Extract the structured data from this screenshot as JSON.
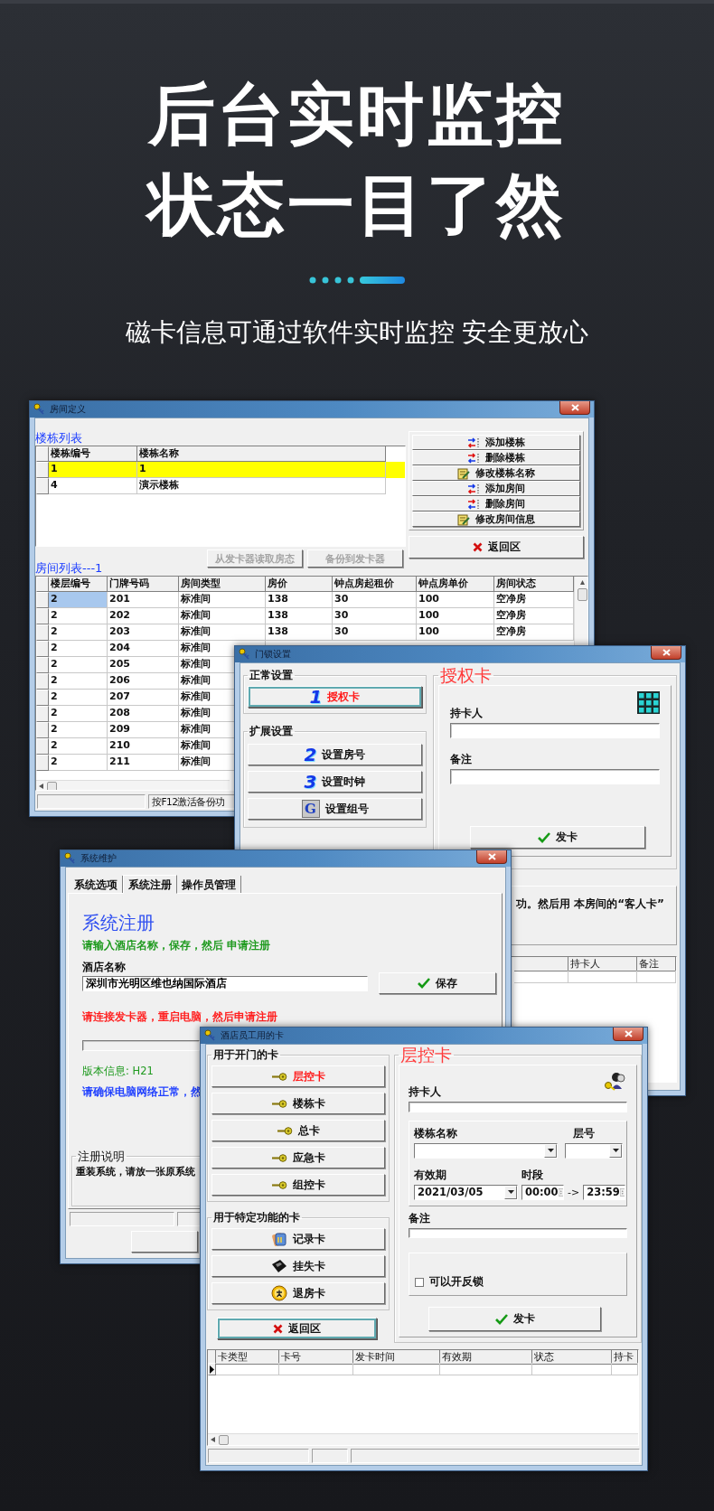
{
  "headline": [
    "后台实时监控",
    "状态一目了然"
  ],
  "subtitle": "磁卡信息可通过软件实时监控 安全更放心",
  "room_window": {
    "title": "房间定义",
    "building_list": {
      "label": "楼栋列表",
      "columns": [
        "楼栋编号",
        "楼栋名称"
      ],
      "rows": [
        {
          "cells": [
            "1",
            "1"
          ],
          "selected": true
        },
        {
          "cells": [
            "4",
            "演示楼栋"
          ],
          "selected": false
        }
      ]
    },
    "actions": [
      {
        "label": "添加楼栋",
        "kind": "add"
      },
      {
        "label": "删除楼栋",
        "kind": "remove"
      },
      {
        "label": "修改楼栋名称",
        "kind": "edit"
      },
      {
        "label": "添加房间",
        "kind": "add"
      },
      {
        "label": "删除房间",
        "kind": "remove"
      },
      {
        "label": "修改房间信息",
        "kind": "edit"
      }
    ],
    "sync_buttons": [
      {
        "label": "从发卡器读取房态",
        "disabled": true
      },
      {
        "label": "备份到发卡器",
        "disabled": true
      }
    ],
    "back_button": "返回区",
    "room_list": {
      "label": "房间列表---1",
      "columns": [
        "楼层编号",
        "门牌号码",
        "房间类型",
        "房价",
        "钟点房起租价",
        "钟点房单价",
        "房间状态"
      ],
      "rows": [
        {
          "cells": [
            "2",
            "201",
            "标准间",
            "138",
            "30",
            "100",
            "空净房"
          ],
          "selected": true
        },
        {
          "cells": [
            "2",
            "202",
            "标准间",
            "138",
            "30",
            "100",
            "空净房"
          ],
          "selected": false
        },
        {
          "cells": [
            "2",
            "203",
            "标准间",
            "138",
            "30",
            "100",
            "空净房"
          ],
          "selected": false
        },
        {
          "cells": [
            "2",
            "204",
            "标准间"
          ],
          "selected": false
        },
        {
          "cells": [
            "2",
            "205",
            "标准间"
          ],
          "selected": false
        },
        {
          "cells": [
            "2",
            "206",
            "标准间"
          ],
          "selected": false
        },
        {
          "cells": [
            "2",
            "207",
            "标准间"
          ],
          "selected": false
        },
        {
          "cells": [
            "2",
            "208",
            "标准间"
          ],
          "selected": false
        },
        {
          "cells": [
            "2",
            "209",
            "标准间"
          ],
          "selected": false
        },
        {
          "cells": [
            "2",
            "210",
            "标准间"
          ],
          "selected": false
        },
        {
          "cells": [
            "2",
            "211",
            "标准间"
          ],
          "selected": false
        }
      ]
    },
    "status_bar": "按F12激活备份功"
  },
  "lock_window": {
    "title": "门锁设置",
    "normal_group": {
      "label": "正常设置",
      "buttons": [
        {
          "number": "1",
          "kind": "digit",
          "label": "授权卡",
          "selected": true
        }
      ]
    },
    "extended_group": {
      "label": "扩展设置",
      "buttons": [
        {
          "number": "2",
          "kind": "digit",
          "label": "设置房号",
          "selected": false
        },
        {
          "number": "3",
          "kind": "digit",
          "label": "设置时钟",
          "selected": false
        },
        {
          "number": "G",
          "kind": "letter",
          "label": "设置组号",
          "selected": false
        }
      ]
    },
    "card_panel": {
      "title": "授权卡",
      "holder_label": "持卡人",
      "remark_label": "备注",
      "issue_button": "发卡"
    },
    "message": "功。然后用 本房间的“客人卡”",
    "table_columns": [
      "持卡人",
      "备注"
    ]
  },
  "system_window": {
    "title": "系统维护",
    "tabs": [
      {
        "label": "系统选项",
        "selected": false
      },
      {
        "label": "系统注册",
        "selected": true
      },
      {
        "label": "操作员管理",
        "selected": false
      }
    ],
    "heading": "系统注册",
    "hint": "请输入酒店名称，保存，然后 申请注册",
    "name_label": "酒店名称",
    "name_value": "深圳市光明区维也纳国际酒店",
    "save_button": "保存",
    "warning": "请连接发卡器，重启电脑，然后申请注册",
    "version": "版本信息: H21",
    "network_note": "请确保电脑网络正常，然",
    "notes_group": {
      "label": "注册说明",
      "text": "重装系统，请放一张原系统"
    }
  },
  "staff_window": {
    "title": "酒店员工用的卡",
    "door_group": {
      "label": "用于开门的卡",
      "cards": [
        {
          "label": "层控卡",
          "kind": "key",
          "selected": true
        },
        {
          "label": "楼栋卡",
          "kind": "key",
          "selected": false
        },
        {
          "label": "总卡",
          "kind": "key",
          "selected": false
        },
        {
          "label": "应急卡",
          "kind": "key",
          "selected": false
        },
        {
          "label": "组控卡",
          "kind": "key",
          "selected": false
        }
      ]
    },
    "function_group": {
      "label": "用于特定功能的卡",
      "cards": [
        {
          "label": "记录卡",
          "kind": "record",
          "selected": false
        },
        {
          "label": "挂失卡",
          "kind": "lost",
          "selected": false
        },
        {
          "label": "退房卡",
          "kind": "checkout",
          "selected": false
        }
      ]
    },
    "back_button": "返回区",
    "card_panel": {
      "title": "层控卡",
      "holder_label": "持卡人",
      "building_label": "楼栋名称",
      "floor_label": "层号",
      "valid_label": "有效期",
      "valid_value": "2021/03/05",
      "period_label": "时段",
      "start_time": "00:00",
      "arrow": "->",
      "end_time": "23:59",
      "remark_label": "备注",
      "reverse_lock": {
        "label": "可以开反锁",
        "checked": false
      },
      "issue_button": "发卡"
    },
    "table_columns": [
      "卡类型",
      "卡号",
      "发卡时间",
      "有效期",
      "状态",
      "持卡"
    ]
  }
}
